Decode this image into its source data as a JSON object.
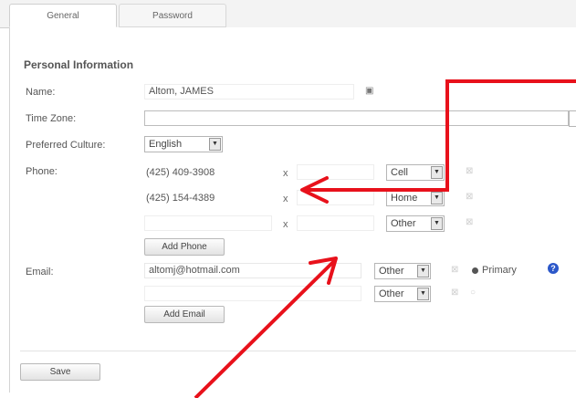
{
  "tabs": {
    "general": "General",
    "password": "Password"
  },
  "section": {
    "title": "Personal Information"
  },
  "fields": {
    "name_label": "Name:",
    "name_value": "Altom, JAMES",
    "timezone_label": "Time Zone:",
    "timezone_value": "",
    "culture_label": "Preferred Culture:",
    "culture_value": "English",
    "phone_label": "Phone:",
    "email_label": "Email:"
  },
  "phones": [
    {
      "number": "(425) 409-3908",
      "x": "x",
      "type": "Cell"
    },
    {
      "number": "(425) 154-4389",
      "x": "x",
      "type": "Home"
    },
    {
      "number": "",
      "x": "x",
      "type": "Other"
    }
  ],
  "emails": [
    {
      "address": "altomj@hotmail.com",
      "type": "Other",
      "primary_label": "Primary"
    },
    {
      "address": "",
      "type": "Other"
    }
  ],
  "buttons": {
    "add_phone": "Add Phone",
    "add_email": "Add Email",
    "save": "Save"
  },
  "help_icon": "?",
  "colors": {
    "annotation_arrow": "#e8111b",
    "help_icon": "#2b57c9"
  }
}
